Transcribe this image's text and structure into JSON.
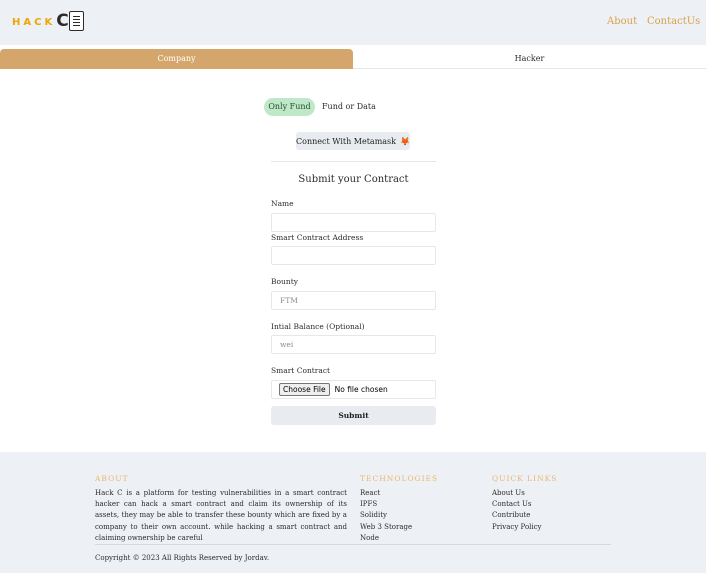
{
  "header": {
    "logo_text": "HACK",
    "logo_letter": "C",
    "nav": {
      "about": "About",
      "contact": "ContactUs"
    }
  },
  "tabs": {
    "company": "Company",
    "hacker": "Hacker"
  },
  "toggle": {
    "only_fund": "Only Fund",
    "fund_or_data": "Fund or Data"
  },
  "connect_button": {
    "label": "Connect With Metamask",
    "icon": "🦊"
  },
  "form": {
    "title": "Submit your Contract",
    "name_label": "Name",
    "name_value": "",
    "address_label": "Smart Contract Address",
    "address_value": "",
    "bounty_label": "Bounty",
    "bounty_placeholder": "FTM",
    "balance_label": "Intial Balance (Optional)",
    "balance_placeholder": "wei",
    "contract_label": "Smart Contract",
    "file_button": "Choose File",
    "file_status": "No file chosen",
    "submit": "Submit"
  },
  "footer": {
    "about_heading": "ABOUT",
    "about_text": "Hack C is a platform for testing vulnerabilities in a smart contract hacker can hack a smart contract and claim its ownership of its assets, they may be able to transfer these bounty which are fixed by a company to their own account. while hacking a smart contract and claiming ownership be careful",
    "tech_heading": "TECHNOLOGIES",
    "technologies": [
      "React",
      "IPFS",
      "Solidity",
      "Web 3 Storage",
      "Node"
    ],
    "links_heading": "QUICK LINKS",
    "links": [
      "About Us",
      "Contact Us",
      "Contribute",
      "Privacy Policy"
    ],
    "copyright": "Copyright © 2023 All Rights Reserved by Jordav."
  },
  "colors": {
    "accent": "#d4a66c",
    "nav": "#d8a24a",
    "footer_heading": "#eab66a",
    "toggle_active": "#bfe8c8"
  }
}
